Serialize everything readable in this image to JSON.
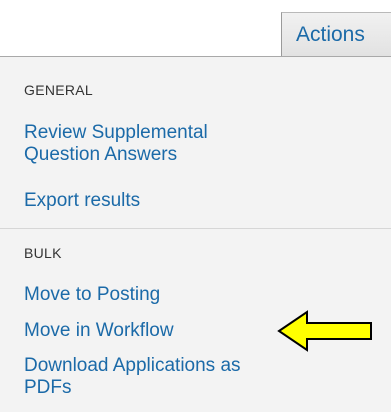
{
  "tab": {
    "label": "Actions"
  },
  "menu": {
    "general": {
      "heading": "GENERAL",
      "items": [
        "Review Supplemental\nQuestion Answers",
        "Export results"
      ]
    },
    "bulk": {
      "heading": "BULK",
      "items": [
        "Move to Posting",
        "Move in Workflow",
        "Download Applications as\nPDFs"
      ]
    }
  },
  "annotation": {
    "type": "arrow-left",
    "color": "#ffff00",
    "outline": "#000000"
  }
}
